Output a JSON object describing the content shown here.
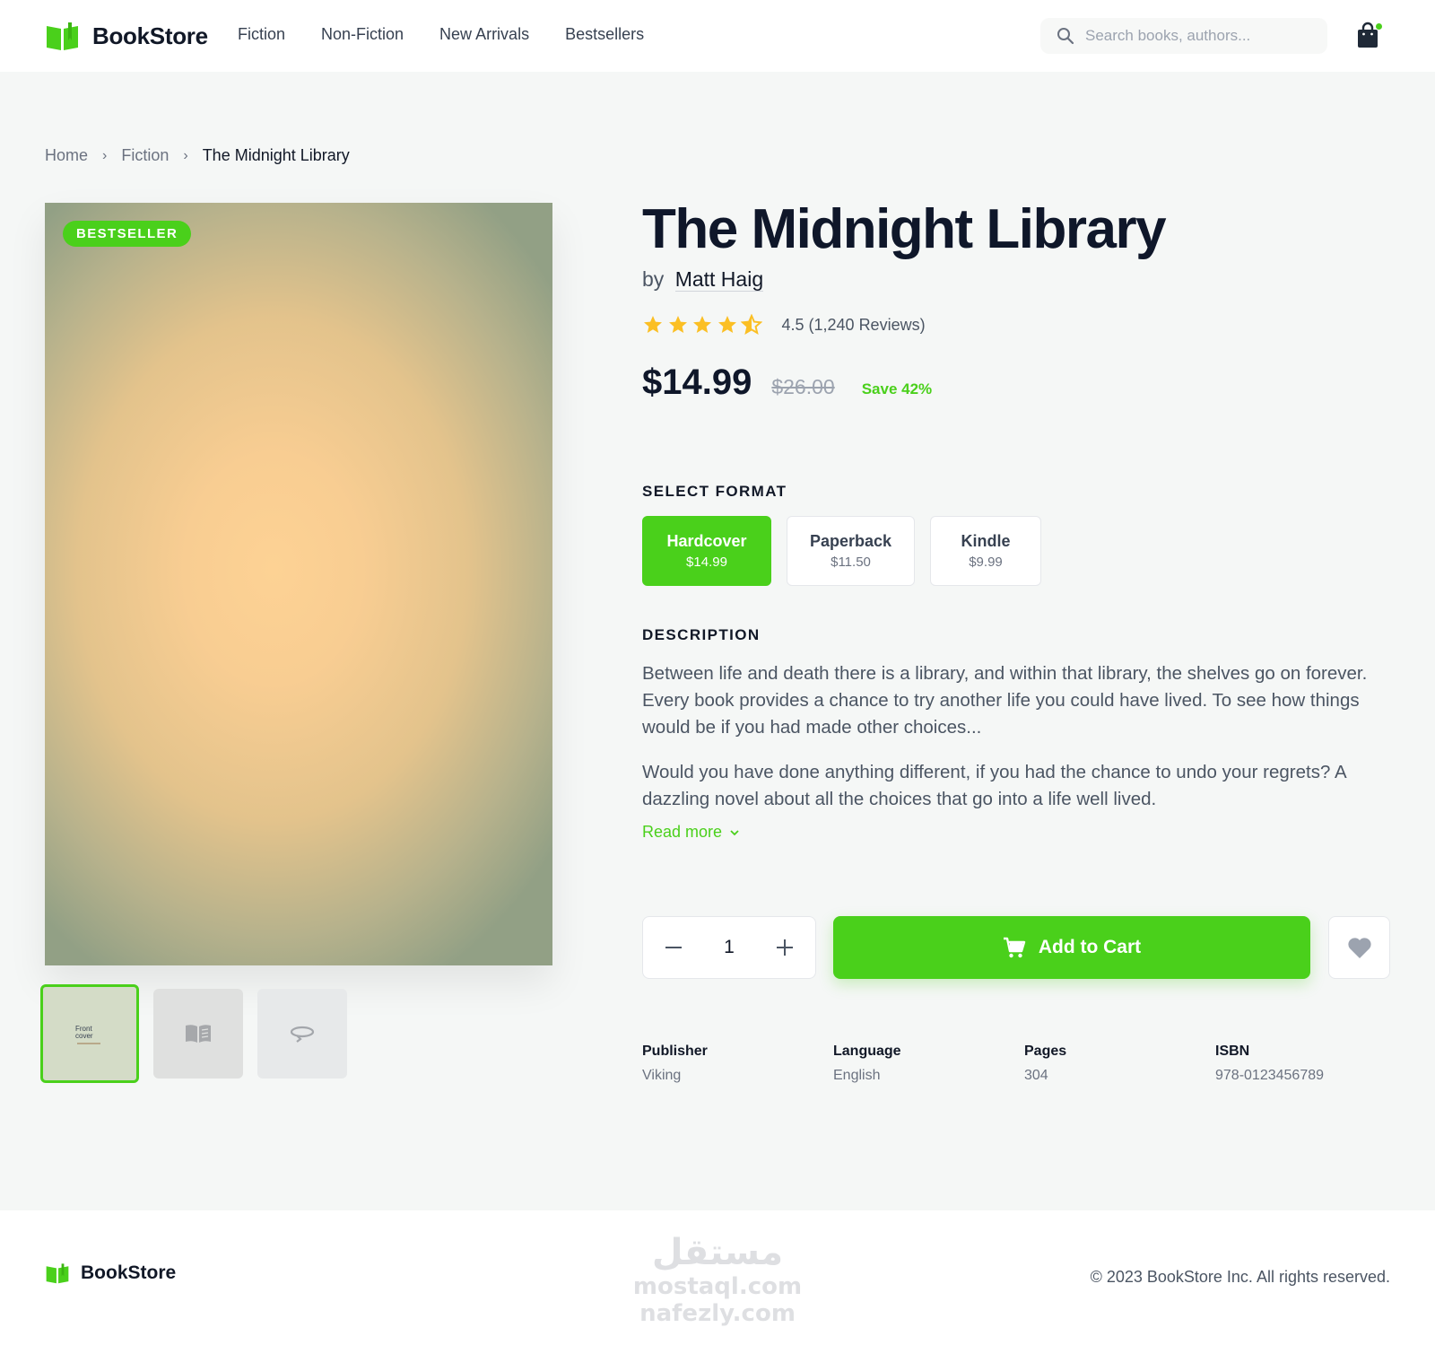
{
  "header": {
    "brand": "BookStore",
    "nav": [
      "Fiction",
      "Non-Fiction",
      "New Arrivals",
      "Bestsellers"
    ],
    "search_placeholder": "Search books, authors..."
  },
  "breadcrumb": {
    "home": "Home",
    "category": "Fiction",
    "current": "The Midnight Library",
    "separator": "›"
  },
  "product": {
    "badge": "BESTSELLER",
    "title": "The Midnight Library",
    "by": "by",
    "author": "Matt Haig",
    "rating_value": 4.5,
    "rating_text": "4.5 (1,240 Reviews)",
    "price": "$14.99",
    "old_price": "$26.00",
    "save": "Save 42%",
    "thumbnail_label": "Front cover"
  },
  "format": {
    "label": "SELECT FORMAT",
    "options": [
      {
        "name": "Hardcover",
        "price": "$14.99",
        "selected": true
      },
      {
        "name": "Paperback",
        "price": "$11.50",
        "selected": false
      },
      {
        "name": "Kindle",
        "price": "$9.99",
        "selected": false
      }
    ]
  },
  "description": {
    "label": "DESCRIPTION",
    "paragraphs": [
      "Between life and death there is a library, and within that library, the shelves go on forever. Every book provides a chance to try another life you could have lived. To see how things would be if you had made other choices...",
      "Would you have done anything different, if you had the chance to undo your regrets? A dazzling novel about all the choices that go into a life well lived."
    ],
    "read_more": "Read more"
  },
  "purchase": {
    "quantity": "1",
    "decrement": "−",
    "increment": "+",
    "add_to_cart": "Add to Cart"
  },
  "specs": [
    {
      "label": "Publisher",
      "value": "Viking"
    },
    {
      "label": "Language",
      "value": "English"
    },
    {
      "label": "Pages",
      "value": "304"
    },
    {
      "label": "ISBN",
      "value": "978-0123456789"
    }
  ],
  "footer": {
    "brand": "BookStore",
    "copyright": "© 2023 BookStore Inc. All rights reserved.",
    "watermark": [
      "مستقل",
      "mostaql.com",
      "nafezly.com"
    ]
  },
  "colors": {
    "accent": "#4ad01b",
    "star": "#fbbf24",
    "text_dark": "#0f172a",
    "background": "#f5f7f6"
  },
  "icons": [
    "book-logo-icon",
    "search-icon",
    "shopping-bag-icon",
    "star-icon",
    "star-half-icon",
    "chevron-down-icon",
    "minus-icon",
    "plus-icon",
    "cart-icon",
    "heart-icon",
    "open-book-icon",
    "rotate-icon"
  ]
}
